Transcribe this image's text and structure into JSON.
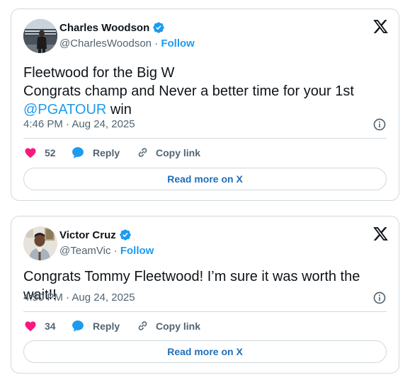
{
  "tweets": [
    {
      "author": {
        "name": "Charles Woodson",
        "handle": "@CharlesWoodson",
        "verified": true,
        "avatar": "stadium-person-avatar"
      },
      "follow_label": "Follow",
      "separator": "·",
      "text_lines": [
        "Fleetwood for the Big W",
        "Congrats champ and Never a better time for your 1st"
      ],
      "mention": "@PGATOUR",
      "text_after_mention": " win",
      "timestamp": "4:46 PM · Aug 24, 2025",
      "like_count": "52",
      "reply_label": "Reply",
      "copy_link_label": "Copy link",
      "read_more_label": "Read more on X"
    },
    {
      "author": {
        "name": "Victor Cruz",
        "handle": "@TeamVic",
        "verified": true,
        "avatar": "person-portrait-avatar"
      },
      "follow_label": "Follow",
      "separator": "·",
      "text_lines": [
        "Congrats Tommy Fleetwood! I’m sure it was worth the wait!!"
      ],
      "timestamp": "4:50 PM · Aug 24, 2025",
      "like_count": "34",
      "reply_label": "Reply",
      "copy_link_label": "Copy link",
      "read_more_label": "Read more on X"
    }
  ],
  "icons": {
    "logo": "x-logo-icon",
    "verified": "verified-badge-icon",
    "info": "info-icon",
    "like": "heart-icon",
    "reply": "speech-bubble-icon",
    "copy": "link-icon"
  },
  "colors": {
    "accent": "#1d9bf0",
    "link_button_text": "#1d6fb8",
    "heart": "#f91880",
    "muted_text": "#536471",
    "border": "#cfd9de",
    "text": "#0f1419"
  }
}
